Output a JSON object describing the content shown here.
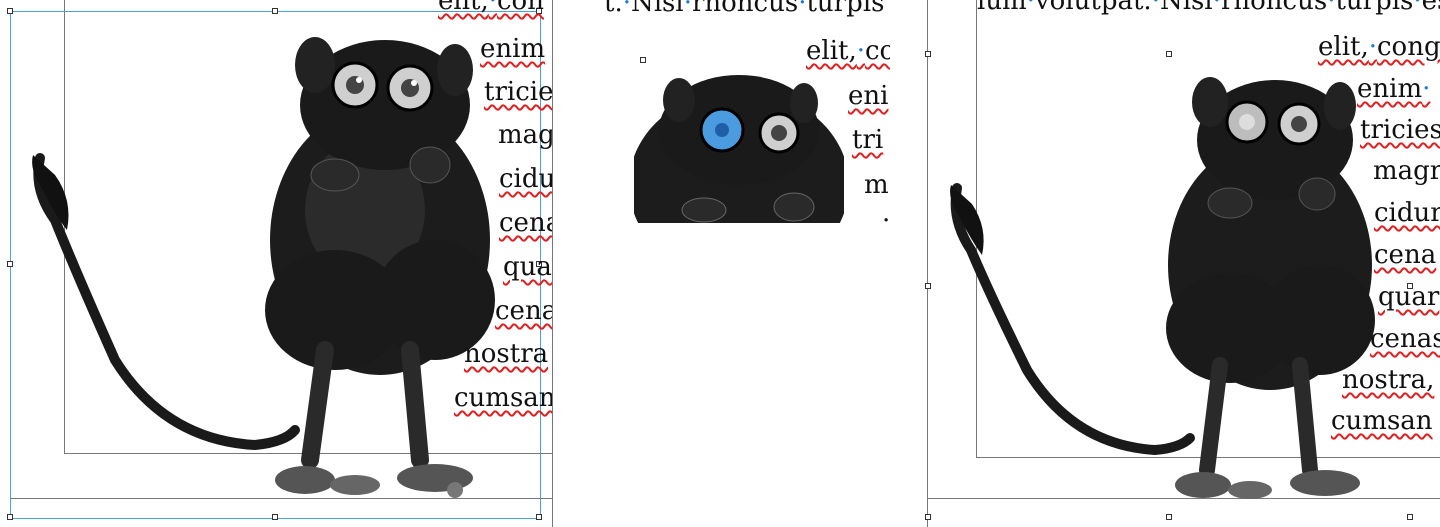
{
  "panel_left": {
    "top_line": "elit,·con",
    "lines": [
      "enim",
      "tricie",
      "mag",
      "cidu",
      "cena",
      "qua",
      "cena",
      "nostra",
      "cumsan"
    ]
  },
  "panel_middle": {
    "top_line": "t.·Nisl·rhoncus·turpis",
    "lines": [
      "elit,·co",
      "eni",
      "tri",
      "m",
      "."
    ]
  },
  "panel_right": {
    "top_line": "lum·volutpat.·Nisl·rhoncus·turpis·es",
    "lines": [
      "elit,·cong",
      "enim·",
      "tricies",
      "magr",
      "cidur",
      "cena",
      "quar",
      "cenas",
      "nostra,",
      "cumsan"
    ]
  },
  "icons": {
    "image": "tarsier-engraving-image",
    "handle": "selection-handle-icon"
  },
  "colors": {
    "spell_underline": "#e02020",
    "selection_frame": "#4aa0d8",
    "hidden_char": "#1e7bd6",
    "eye_highlight": "#4a9be0"
  }
}
